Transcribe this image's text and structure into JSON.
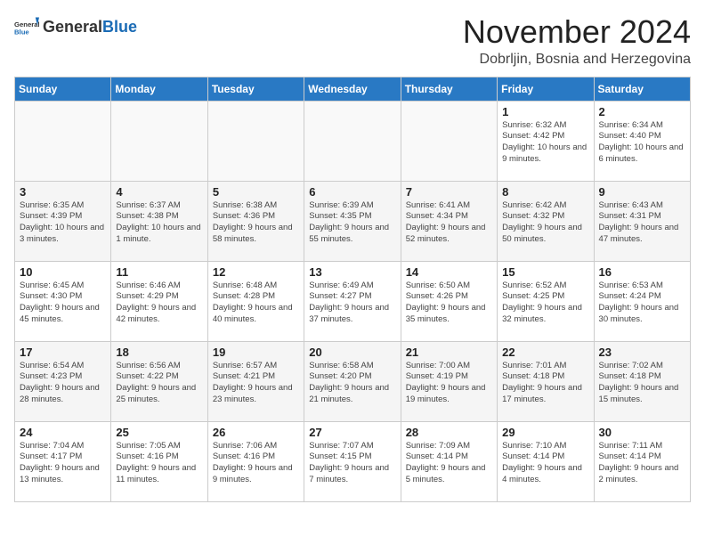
{
  "header": {
    "logo_general": "General",
    "logo_blue": "Blue",
    "month_title": "November 2024",
    "location": "Dobrljin, Bosnia and Herzegovina"
  },
  "weekdays": [
    "Sunday",
    "Monday",
    "Tuesday",
    "Wednesday",
    "Thursday",
    "Friday",
    "Saturday"
  ],
  "weeks": [
    [
      {
        "day": "",
        "info": ""
      },
      {
        "day": "",
        "info": ""
      },
      {
        "day": "",
        "info": ""
      },
      {
        "day": "",
        "info": ""
      },
      {
        "day": "",
        "info": ""
      },
      {
        "day": "1",
        "info": "Sunrise: 6:32 AM\nSunset: 4:42 PM\nDaylight: 10 hours and 9 minutes."
      },
      {
        "day": "2",
        "info": "Sunrise: 6:34 AM\nSunset: 4:40 PM\nDaylight: 10 hours and 6 minutes."
      }
    ],
    [
      {
        "day": "3",
        "info": "Sunrise: 6:35 AM\nSunset: 4:39 PM\nDaylight: 10 hours and 3 minutes."
      },
      {
        "day": "4",
        "info": "Sunrise: 6:37 AM\nSunset: 4:38 PM\nDaylight: 10 hours and 1 minute."
      },
      {
        "day": "5",
        "info": "Sunrise: 6:38 AM\nSunset: 4:36 PM\nDaylight: 9 hours and 58 minutes."
      },
      {
        "day": "6",
        "info": "Sunrise: 6:39 AM\nSunset: 4:35 PM\nDaylight: 9 hours and 55 minutes."
      },
      {
        "day": "7",
        "info": "Sunrise: 6:41 AM\nSunset: 4:34 PM\nDaylight: 9 hours and 52 minutes."
      },
      {
        "day": "8",
        "info": "Sunrise: 6:42 AM\nSunset: 4:32 PM\nDaylight: 9 hours and 50 minutes."
      },
      {
        "day": "9",
        "info": "Sunrise: 6:43 AM\nSunset: 4:31 PM\nDaylight: 9 hours and 47 minutes."
      }
    ],
    [
      {
        "day": "10",
        "info": "Sunrise: 6:45 AM\nSunset: 4:30 PM\nDaylight: 9 hours and 45 minutes."
      },
      {
        "day": "11",
        "info": "Sunrise: 6:46 AM\nSunset: 4:29 PM\nDaylight: 9 hours and 42 minutes."
      },
      {
        "day": "12",
        "info": "Sunrise: 6:48 AM\nSunset: 4:28 PM\nDaylight: 9 hours and 40 minutes."
      },
      {
        "day": "13",
        "info": "Sunrise: 6:49 AM\nSunset: 4:27 PM\nDaylight: 9 hours and 37 minutes."
      },
      {
        "day": "14",
        "info": "Sunrise: 6:50 AM\nSunset: 4:26 PM\nDaylight: 9 hours and 35 minutes."
      },
      {
        "day": "15",
        "info": "Sunrise: 6:52 AM\nSunset: 4:25 PM\nDaylight: 9 hours and 32 minutes."
      },
      {
        "day": "16",
        "info": "Sunrise: 6:53 AM\nSunset: 4:24 PM\nDaylight: 9 hours and 30 minutes."
      }
    ],
    [
      {
        "day": "17",
        "info": "Sunrise: 6:54 AM\nSunset: 4:23 PM\nDaylight: 9 hours and 28 minutes."
      },
      {
        "day": "18",
        "info": "Sunrise: 6:56 AM\nSunset: 4:22 PM\nDaylight: 9 hours and 25 minutes."
      },
      {
        "day": "19",
        "info": "Sunrise: 6:57 AM\nSunset: 4:21 PM\nDaylight: 9 hours and 23 minutes."
      },
      {
        "day": "20",
        "info": "Sunrise: 6:58 AM\nSunset: 4:20 PM\nDaylight: 9 hours and 21 minutes."
      },
      {
        "day": "21",
        "info": "Sunrise: 7:00 AM\nSunset: 4:19 PM\nDaylight: 9 hours and 19 minutes."
      },
      {
        "day": "22",
        "info": "Sunrise: 7:01 AM\nSunset: 4:18 PM\nDaylight: 9 hours and 17 minutes."
      },
      {
        "day": "23",
        "info": "Sunrise: 7:02 AM\nSunset: 4:18 PM\nDaylight: 9 hours and 15 minutes."
      }
    ],
    [
      {
        "day": "24",
        "info": "Sunrise: 7:04 AM\nSunset: 4:17 PM\nDaylight: 9 hours and 13 minutes."
      },
      {
        "day": "25",
        "info": "Sunrise: 7:05 AM\nSunset: 4:16 PM\nDaylight: 9 hours and 11 minutes."
      },
      {
        "day": "26",
        "info": "Sunrise: 7:06 AM\nSunset: 4:16 PM\nDaylight: 9 hours and 9 minutes."
      },
      {
        "day": "27",
        "info": "Sunrise: 7:07 AM\nSunset: 4:15 PM\nDaylight: 9 hours and 7 minutes."
      },
      {
        "day": "28",
        "info": "Sunrise: 7:09 AM\nSunset: 4:14 PM\nDaylight: 9 hours and 5 minutes."
      },
      {
        "day": "29",
        "info": "Sunrise: 7:10 AM\nSunset: 4:14 PM\nDaylight: 9 hours and 4 minutes."
      },
      {
        "day": "30",
        "info": "Sunrise: 7:11 AM\nSunset: 4:14 PM\nDaylight: 9 hours and 2 minutes."
      }
    ]
  ]
}
